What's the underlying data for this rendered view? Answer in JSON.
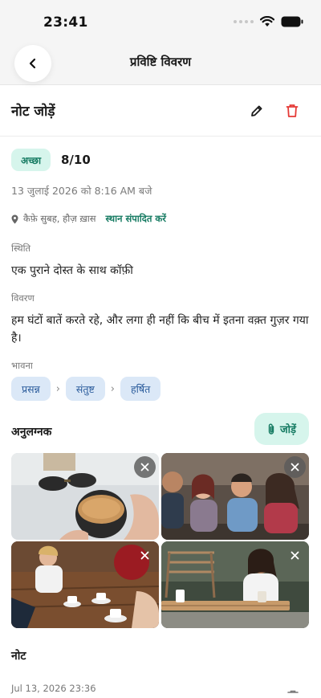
{
  "status_bar": {
    "time": "23:41"
  },
  "nav": {
    "title": "प्रविष्टि विवरण"
  },
  "entry": {
    "title": "नोट जोड़ें",
    "rating_label": "अच्छा",
    "rating_score": "8/10",
    "date": "13 जुलाई 2026 को 8:16 AM बजे",
    "location": "कैफ़े सुबह, हौज़ ख़ास",
    "edit_location_label": "स्थान संपादित करें",
    "situation_label": "स्थिति",
    "situation_text": "एक पुराने दोस्त के साथ कॉफ़ी",
    "description_label": "विवरण",
    "description_text": "हम घंटों बातें करते रहे, और लगा ही नहीं कि बीच में इतना वक़्त गुज़र गया है।",
    "emotions_label": "भावना",
    "emotions": [
      "प्रसन्न",
      "संतुष्ट",
      "हर्षित"
    ]
  },
  "attachments": {
    "heading": "अनुलग्नक",
    "add_label": "जोड़ें"
  },
  "notes": {
    "heading": "नोट",
    "items": [
      {
        "timestamp": "Jul 13, 2026 23:36"
      }
    ]
  },
  "colors": {
    "accent_green": "#147a61",
    "accent_green_bg": "#d6f5ec",
    "chip_blue_bg": "#dbe8f7",
    "chip_blue_text": "#2b5c9c",
    "delete_red": "#e53935"
  },
  "icons": [
    "back-chevron-icon",
    "pencil-icon",
    "trash-icon",
    "location-pin-icon",
    "chevron-right-icon",
    "paperclip-icon",
    "close-icon",
    "wifi-icon",
    "battery-icon"
  ]
}
